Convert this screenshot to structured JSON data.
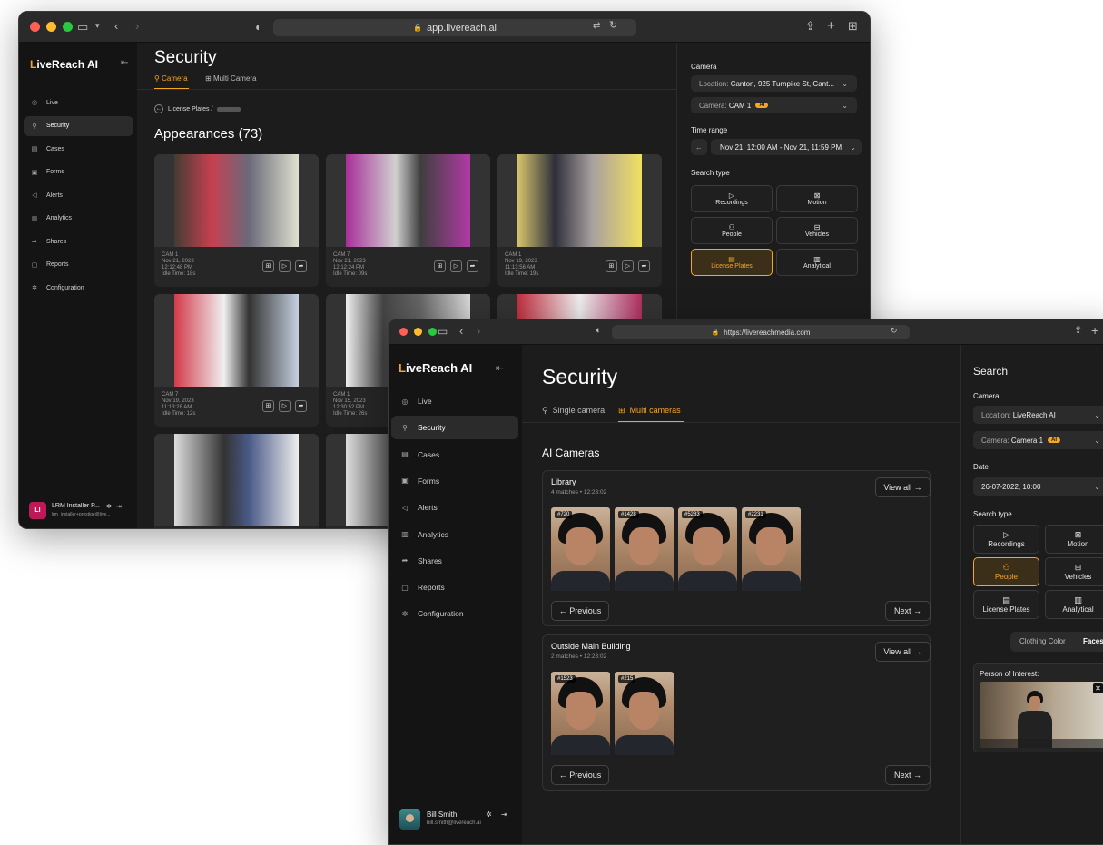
{
  "back_window": {
    "url": "app.livereach.ai",
    "logo": {
      "accent": "L",
      "rest1": "ive",
      "rest2": "Reach AI"
    },
    "nav": [
      {
        "label": "Live",
        "icon": "live-icon"
      },
      {
        "label": "Security",
        "icon": "security-camera-icon"
      },
      {
        "label": "Cases",
        "icon": "cases-icon"
      },
      {
        "label": "Forms",
        "icon": "forms-icon"
      },
      {
        "label": "Alerts",
        "icon": "alerts-icon"
      },
      {
        "label": "Analytics",
        "icon": "analytics-icon"
      },
      {
        "label": "Shares",
        "icon": "shares-icon"
      },
      {
        "label": "Reports",
        "icon": "reports-icon"
      },
      {
        "label": "Configuration",
        "icon": "gear-icon"
      }
    ],
    "user": {
      "initials": "LI",
      "name": "LRM Installer P...",
      "email": "lrm_installer+prestige@live..."
    },
    "title": "Security",
    "tabs": [
      "Camera",
      "Multi Camera"
    ],
    "breadcrumb": "License Plates /",
    "appearances": "Appearances (73)",
    "cards": [
      {
        "cam": "CAM 1",
        "date": "Nov 21, 2023",
        "time": "12:12:48 PM",
        "idle": "Idle Time: 18s"
      },
      {
        "cam": "CAM 7",
        "date": "Nov 21, 2023",
        "time": "12:12:24 PM",
        "idle": "Idle Time: 09s"
      },
      {
        "cam": "CAM 1",
        "date": "Nov 19, 2023",
        "time": "11:13:56 AM",
        "idle": "Idle Time: 19s"
      },
      {
        "cam": "CAM 7",
        "date": "Nov 19, 2023",
        "time": "11:13:28 AM",
        "idle": "Idle Time: 12s"
      },
      {
        "cam": "CAM 1",
        "date": "Nov 15, 2023",
        "time": "12:30:52 PM",
        "idle": "Idle Time: 26s"
      }
    ],
    "panel": {
      "camera_label": "Camera",
      "location_prefix": "Location:",
      "location_value": "Canton, 925 Turnpike St, Cant...",
      "camera_prefix": "Camera:",
      "camera_value": "CAM 1",
      "ai_badge": "AI",
      "time_range_label": "Time range",
      "time_range_value": "Nov 21, 12:00 AM - Nov 21, 11:59 PM",
      "search_type_label": "Search type",
      "search_types": [
        "Recordings",
        "Motion",
        "People",
        "Vehicles",
        "License Plates",
        "Analytical"
      ]
    }
  },
  "front_window": {
    "url": "https://livereachmedia.com",
    "logo": {
      "accent": "L",
      "rest1": "ive",
      "rest2": "Reach AI"
    },
    "nav": [
      {
        "label": "Live",
        "icon": "live-icon"
      },
      {
        "label": "Security",
        "icon": "security-camera-icon"
      },
      {
        "label": "Cases",
        "icon": "cases-icon"
      },
      {
        "label": "Forms",
        "icon": "forms-icon"
      },
      {
        "label": "Alerts",
        "icon": "alerts-icon"
      },
      {
        "label": "Analytics",
        "icon": "analytics-icon"
      },
      {
        "label": "Shares",
        "icon": "shares-icon"
      },
      {
        "label": "Reports",
        "icon": "reports-icon"
      },
      {
        "label": "Configuration",
        "icon": "gear-icon"
      }
    ],
    "user": {
      "name": "Bill Smith",
      "email": "bill.smith@livereach.ai"
    },
    "title": "Security",
    "tabs": [
      "Single camera",
      "Multi cameras"
    ],
    "section_title": "AI Cameras",
    "groups": [
      {
        "name": "Library",
        "matches": "4 matches",
        "time": "12:23:02",
        "view_all": "View all →",
        "tags": [
          "#720",
          "#1428",
          "#5283",
          "#2231"
        ],
        "prev": "← Previous",
        "next": "Next →"
      },
      {
        "name": "Outside Main Building",
        "matches": "2 matches",
        "time": "12:23:02",
        "view_all": "View all →",
        "tags": [
          "#1523",
          "#215"
        ],
        "prev": "← Previous",
        "next": "Next →"
      }
    ],
    "panel": {
      "search_title": "Search",
      "camera_label": "Camera",
      "location_prefix": "Location:",
      "location_value": "LiveReach AI",
      "camera_prefix": "Camera:",
      "camera_value": "Camera 1",
      "ai_badge": "AI",
      "date_label": "Date",
      "date_value": "26-07-2022, 10:00",
      "search_type_label": "Search type",
      "search_types": [
        "Recordings",
        "Motion",
        "People",
        "Vehicles",
        "License Plates",
        "Analytical"
      ],
      "filter_tabs": [
        "Clothing Color",
        "Faces"
      ],
      "poi_label": "Person of Interest:"
    }
  },
  "colors": {
    "accent": "#f5a623",
    "bg": "#1c1c1c",
    "sidebar": "#141414"
  }
}
